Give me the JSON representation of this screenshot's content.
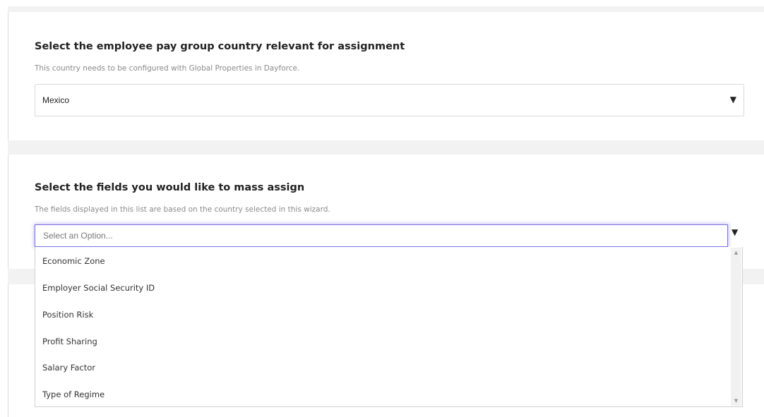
{
  "country_section": {
    "title": "Select the employee pay group country relevant for assignment",
    "help_text": "This country needs to be configured with Global Properties in Dayforce.",
    "selected_value": "Mexico",
    "arrow_glyph": "▼"
  },
  "fields_section": {
    "title": "Select the fields you would like to mass assign",
    "help_text": "The fields displayed in this list are based on the country selected in this wizard.",
    "placeholder": "Select an Option...",
    "arrow_glyph": "▼",
    "options": [
      "Economic Zone",
      "Employer Social Security ID",
      "Position Risk",
      "Profit Sharing",
      "Salary Factor",
      "Type of Regime"
    ],
    "scroll_up_glyph": "▲",
    "scroll_down_glyph": "▼"
  }
}
